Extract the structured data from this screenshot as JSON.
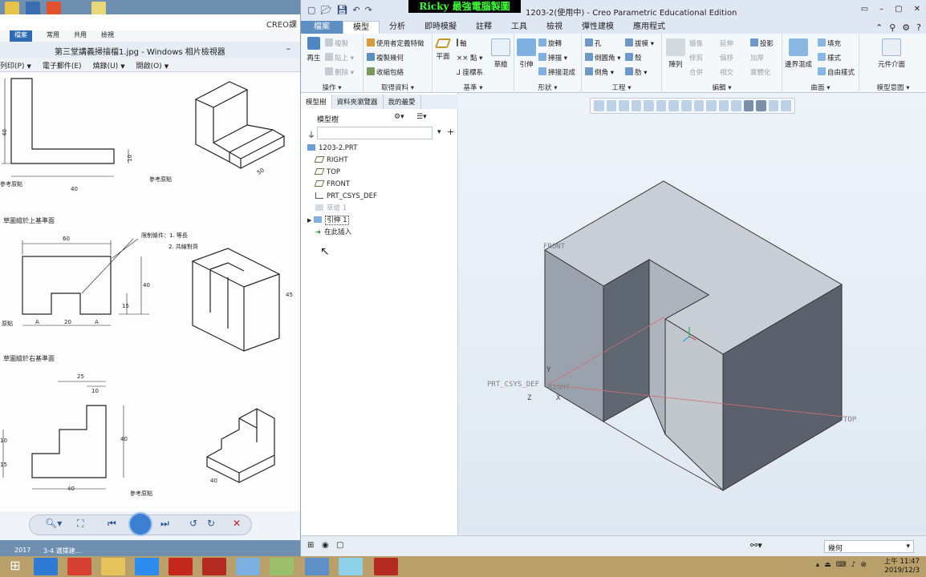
{
  "photo_viewer": {
    "behind_title": "CREO課",
    "ribbon_tabs": [
      "檔案",
      "常用",
      "共用",
      "檢視"
    ],
    "title": "第三堂講義掃描檔1.jpg - Windows 相片檢視器",
    "menu": [
      "列印(P)",
      "電子郵件(E)",
      "燒錄(U)",
      "開啟(O)"
    ],
    "figure": {
      "fig1": {
        "dim_h": "40",
        "dim_w": "40",
        "dim_t": "10",
        "ref": "參考原點",
        "ref_left": "參考原點",
        "depth": "50"
      },
      "caption2": "草圖繪於上基準面",
      "fig2": {
        "dim_top": "60",
        "note1": "限制條件：1. 等長",
        "note2": "2. 共線對齊",
        "dim_h": "40",
        "dim_15": "15",
        "dim_a1": "A",
        "dim_20": "20",
        "dim_a2": "A",
        "ref": "原點",
        "depth": "45"
      },
      "caption3": "草圖繪於右基準面",
      "fig3": {
        "dim_25": "25",
        "dim_10": "10",
        "dim_h": "40",
        "dim_10b": "10",
        "dim_15": "15",
        "dim_40": "40",
        "ref": "參考原點",
        "depth": "40"
      }
    },
    "taskbar_caption": "2017",
    "taskbar_caption2": "3-4 選擇建..."
  },
  "creo": {
    "watermark": "Ricky 最強電腦製圖",
    "title": "1203-2(使用中) - Creo Parametric Educational Edition",
    "tabs": [
      "檔案",
      "模型",
      "分析",
      "即時模擬",
      "註釋",
      "工具",
      "檢視",
      "彈性建模",
      "應用程式"
    ],
    "active_tab": "模型",
    "groups": {
      "operations": {
        "label": "操作",
        "regen": "再生",
        "copy": "複製",
        "paste": "貼上",
        "delete": "刪除"
      },
      "get_data": {
        "label": "取得資料",
        "items": [
          "使用者定義特徵",
          "複製幾何",
          "收縮包絡"
        ]
      },
      "datum": {
        "label": "基準",
        "plane": "平面",
        "axis": "軸",
        "point": "點",
        "csys": "座標系",
        "sketch": "草繪"
      },
      "shapes": {
        "label": "形狀",
        "extrude": "引伸",
        "revolve": "旋轉",
        "sweep": "掃描",
        "swept_blend": "掃描混成"
      },
      "engineering": {
        "label": "工程",
        "hole": "孔",
        "draft": "拔模",
        "round": "倒圓角",
        "shell": "殼",
        "chamfer": "倒角",
        "rib": "肋"
      },
      "editing": {
        "label": "編輯",
        "pattern": "陣列",
        "items": [
          "鏡像",
          "延伸",
          "投影",
          "修剪",
          "偏移",
          "加厚",
          "合併",
          "相交",
          "實體化"
        ]
      },
      "surfaces": {
        "label": "曲面",
        "boundary": "邊界混成",
        "fill": "填充",
        "style": "樣式",
        "freestyle": "自由樣式"
      },
      "model_intent": {
        "label": "模型意圖",
        "component": "元件介面"
      }
    },
    "tree_tabs": [
      "模型樹",
      "資料夾瀏覽器",
      "我的最愛"
    ],
    "tree_header": "模型樹",
    "tree_items": [
      {
        "label": "1203-2.PRT"
      },
      {
        "label": "RIGHT"
      },
      {
        "label": "TOP"
      },
      {
        "label": "FRONT"
      },
      {
        "label": "PRT_CSYS_DEF"
      },
      {
        "label": "草繪 1"
      },
      {
        "label": "引伸 1"
      },
      {
        "label": "在此插入"
      }
    ],
    "datum_labels": {
      "front": "FRONT",
      "csys": "PRT_CSYS_DEF",
      "right": "RIGHT",
      "top": "TOP",
      "x": "X",
      "y": "Y",
      "z": "Z"
    },
    "status_filter": "幾何"
  },
  "tray": {
    "time": "上午 11:47",
    "date": "2019/12/3"
  },
  "colors": {
    "creo_blue": "#5f8ec3",
    "model_face_light": "#b8bfcb",
    "model_face_dark": "#6a7280",
    "watermark_green": "#3cff35"
  }
}
